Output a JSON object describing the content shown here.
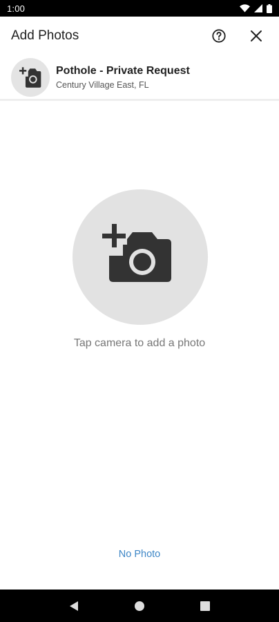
{
  "status_bar": {
    "time": "1:00",
    "icons": [
      "wifi-icon",
      "signal-icon",
      "battery-icon"
    ]
  },
  "app_bar": {
    "title": "Add Photos",
    "actions": [
      "help-icon",
      "close-icon"
    ]
  },
  "request": {
    "title": "Pothole - Private Request",
    "subtitle": "Century Village East, FL",
    "avatar_icon": "add-photo-icon"
  },
  "main": {
    "camera_icon": "add-photo-icon",
    "hint": "Tap camera to add a photo",
    "no_photo_label": "No Photo"
  },
  "nav_bar": {
    "buttons": [
      "back-icon",
      "home-icon",
      "recents-icon"
    ]
  },
  "colors": {
    "accent": "#3d86c6",
    "icon_dark": "#333333",
    "circle_bg": "#e2e2e2"
  }
}
